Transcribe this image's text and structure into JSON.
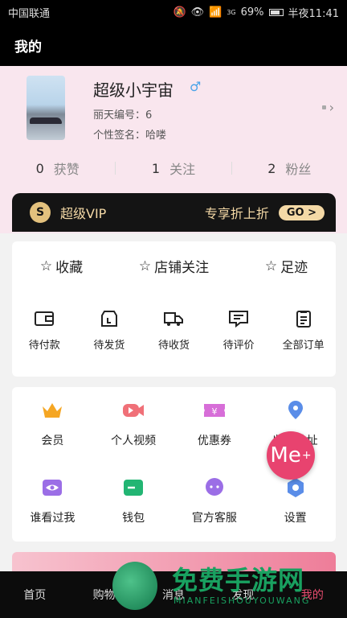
{
  "status_bar": {
    "carrier": "中国联通",
    "battery": "69%",
    "time": "半夜11:41",
    "signal_label": "3G"
  },
  "header": {
    "title": "我的"
  },
  "profile": {
    "name": "超级小宇宙",
    "gender_icon": "male-icon",
    "id_label": "丽天编号：",
    "id_value": "6",
    "signature_label": "个性签名：",
    "signature_value": "哈喽",
    "stats": [
      {
        "count": "0",
        "label": "获赞"
      },
      {
        "count": "1",
        "label": "关注"
      },
      {
        "count": "2",
        "label": "粉丝"
      }
    ]
  },
  "vip": {
    "badge": "S",
    "title": "超级VIP",
    "offer": "专享折上折",
    "go": "GO >"
  },
  "favorites": [
    {
      "icon": "star-icon",
      "label": "收藏"
    },
    {
      "icon": "star-icon",
      "label": "店铺关注"
    },
    {
      "icon": "star-icon",
      "label": "足迹"
    }
  ],
  "orders": [
    {
      "icon": "wallet-icon",
      "label": "待付款"
    },
    {
      "icon": "box-icon",
      "label": "待发货"
    },
    {
      "icon": "truck-icon",
      "label": "待收货"
    },
    {
      "icon": "comment-icon",
      "label": "待评价"
    },
    {
      "icon": "clipboard-icon",
      "label": "全部订单"
    }
  ],
  "services_row1": [
    {
      "icon": "crown-icon",
      "label": "会员",
      "color": "#f5a623"
    },
    {
      "icon": "video-icon",
      "label": "个人视频",
      "color": "#f07078"
    },
    {
      "icon": "coupon-icon",
      "label": "优惠券",
      "color": "#d76ed8"
    },
    {
      "icon": "location-icon",
      "label": "收货地址",
      "color": "#5a8de8"
    }
  ],
  "services_row2": [
    {
      "icon": "eye-icon",
      "label": "谁看过我",
      "color": "#9b6ee6"
    },
    {
      "icon": "wallet-icon",
      "label": "钱包",
      "color": "#22b573"
    },
    {
      "icon": "chat-icon",
      "label": "官方客服",
      "color": "#9b6ee6"
    },
    {
      "icon": "gear-icon",
      "label": "设置",
      "color": "#5a8de8"
    }
  ],
  "float_button": {
    "label": "Me",
    "sup": "+"
  },
  "tabs": [
    {
      "label": "首页"
    },
    {
      "label": "购物"
    },
    {
      "label": "消息"
    },
    {
      "label": "发现"
    },
    {
      "label": "我的"
    }
  ],
  "watermark": {
    "big": "免费手游网",
    "small": "MIANFEISHOUYOUWANG"
  }
}
